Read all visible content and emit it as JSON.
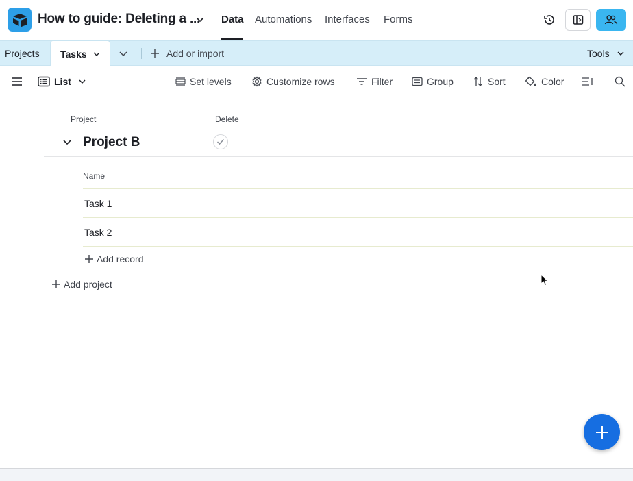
{
  "header": {
    "base_title": "How to guide: Deleting a ...",
    "nav_tabs": [
      {
        "label": "Data",
        "active": true
      },
      {
        "label": "Automations",
        "active": false
      },
      {
        "label": "Interfaces",
        "active": false
      },
      {
        "label": "Forms",
        "active": false
      }
    ],
    "icons": [
      "history-icon",
      "sidebar-toggle-icon",
      "share-icon"
    ],
    "accent_color": "#3ab6f0"
  },
  "tables_bar": {
    "tabs": [
      {
        "label": "Projects",
        "active": false
      },
      {
        "label": "Tasks",
        "active": true
      }
    ],
    "add_label": "Add or import",
    "tools_label": "Tools",
    "background_color": "#d6eef9"
  },
  "view_bar": {
    "view_name": "List",
    "buttons": [
      {
        "label": "Set levels",
        "icon": "levels-icon"
      },
      {
        "label": "Customize rows",
        "icon": "gear-icon"
      },
      {
        "label": "Filter",
        "icon": "filter-icon"
      },
      {
        "label": "Group",
        "icon": "group-icon"
      },
      {
        "label": "Sort",
        "icon": "sort-icon"
      },
      {
        "label": "Color",
        "icon": "paint-bucket-icon"
      }
    ]
  },
  "list": {
    "project_header": "Project",
    "delete_header": "Delete",
    "group": {
      "title": "Project B",
      "name_header": "Name",
      "records": [
        "Task 1",
        "Task 2"
      ],
      "add_record_label": "Add record"
    },
    "add_project_label": "Add project"
  },
  "fab_color": "#166ee1"
}
